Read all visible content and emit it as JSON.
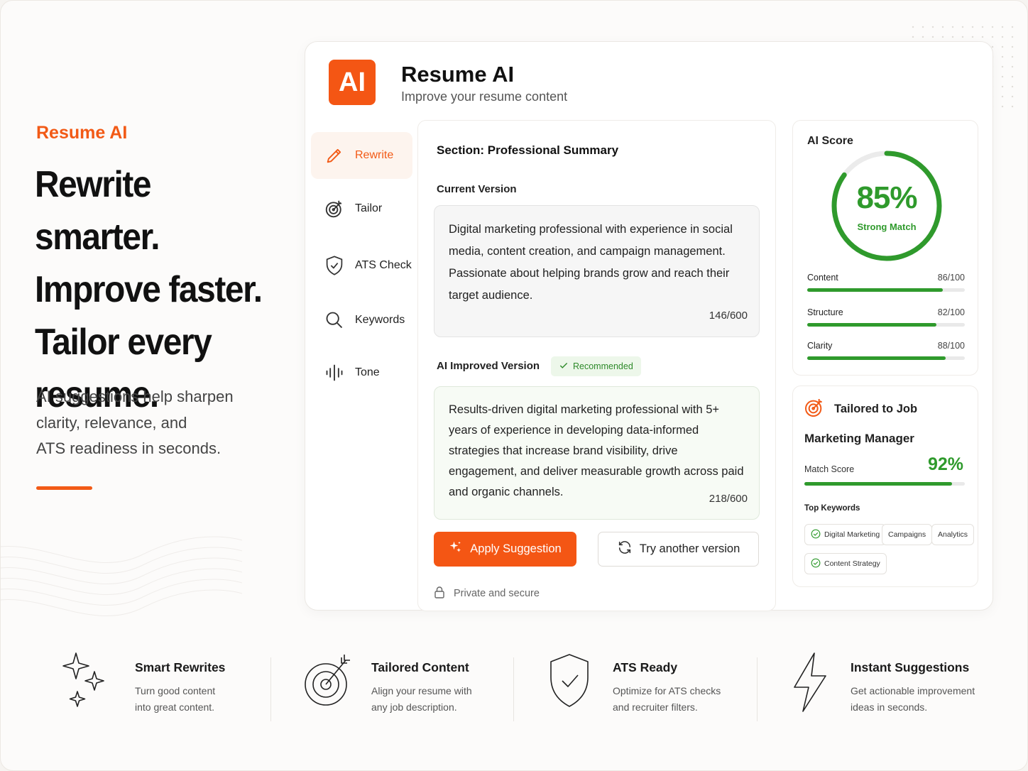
{
  "hero": {
    "brand": "Resume AI",
    "headline": [
      "Rewrite smarter.",
      "Improve faster.",
      "Tailor every",
      "resume."
    ],
    "subtitle": [
      "AI suggestions help sharpen",
      "clarity, relevance, and",
      "ATS readiness in seconds."
    ]
  },
  "app": {
    "logo": "AI",
    "title": "Resume AI",
    "subtitle": "Improve your resume content"
  },
  "sidebar": {
    "items": [
      {
        "label": "Rewrite",
        "icon": "pencil-icon",
        "active": true
      },
      {
        "label": "Tailor",
        "icon": "target-icon",
        "active": false
      },
      {
        "label": "ATS Check",
        "icon": "shield-check-icon",
        "active": false
      },
      {
        "label": "Keywords",
        "icon": "search-icon",
        "active": false
      },
      {
        "label": "Tone",
        "icon": "waveform-icon",
        "active": false
      }
    ]
  },
  "editor": {
    "section": "Section: Professional Summary",
    "current_label": "Current Version",
    "current_text": "Digital marketing professional with experience in social media, content creation, and campaign management. Passionate about helping brands grow and reach their target audience.",
    "current_count": "146/600",
    "improved_label": "AI Improved Version",
    "recommended": "Recommended",
    "improved_text": "Results-driven digital marketing professional with 5+ years of experience in developing data-informed strategies that increase brand visibility, drive engagement, and deliver measurable growth across paid and organic channels.",
    "improved_count": "218/600",
    "apply_label": "Apply Suggestion",
    "try_label": "Try another version",
    "private_label": "Private and secure"
  },
  "score": {
    "title": "AI Score",
    "value": 85,
    "value_text": "85%",
    "status": "Strong Match",
    "metrics": [
      {
        "name": "Content",
        "value": 86,
        "max": 100,
        "text": "86/100"
      },
      {
        "name": "Structure",
        "value": 82,
        "max": 100,
        "text": "82/100"
      },
      {
        "name": "Clarity",
        "value": 88,
        "max": 100,
        "text": "88/100"
      }
    ]
  },
  "job": {
    "heading": "Tailored to Job",
    "title": "Marketing Manager",
    "match_label": "Match Score",
    "match_value": 92,
    "match_text": "92%",
    "keywords_label": "Top Keywords",
    "keywords": [
      {
        "label": "Digital Marketing",
        "checked": true
      },
      {
        "label": "Campaigns",
        "checked": false
      },
      {
        "label": "Analytics",
        "checked": false
      },
      {
        "label": "Content Strategy",
        "checked": true
      }
    ]
  },
  "features": [
    {
      "title": "Smart Rewrites",
      "desc": [
        "Turn good content",
        "into great content."
      ],
      "icon": "sparkles-icon"
    },
    {
      "title": "Tailored Content",
      "desc": [
        "Align your resume with",
        "any job description."
      ],
      "icon": "target-arrow-icon"
    },
    {
      "title": "ATS Ready",
      "desc": [
        "Optimize for ATS checks",
        "and recruiter filters."
      ],
      "icon": "shield-check-icon"
    },
    {
      "title": "Instant Suggestions",
      "desc": [
        "Get actionable improvement",
        "ideas in seconds."
      ],
      "icon": "lightning-icon"
    }
  ],
  "colors": {
    "accent": "#f45614",
    "success": "#2f9a2c"
  }
}
